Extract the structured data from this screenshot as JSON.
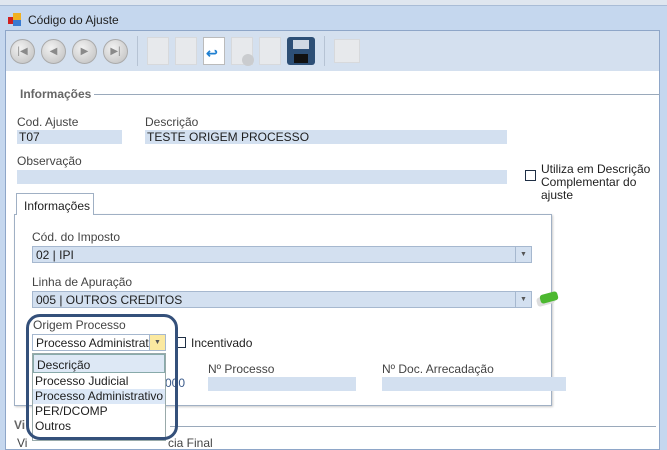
{
  "window": {
    "title": "Código do Ajuste"
  },
  "toolbar": {
    "buttons": [
      "first-icon",
      "previous-icon",
      "next-icon",
      "last-icon",
      "new-icon",
      "edit-icon",
      "undo-icon",
      "delete-icon",
      "redo-icon",
      "save-icon",
      "lock-icon"
    ]
  },
  "info": {
    "group_label": "Informações",
    "cod_label": "Cod. Ajuste",
    "cod_value": "T07",
    "desc_label": "Descrição",
    "desc_value": "TESTE ORIGEM PROCESSO",
    "obs_label": "Observação",
    "obs_value": "",
    "utiliza_label_1": "Utiliza em Descrição",
    "utiliza_label_2": "Complementar do ajuste"
  },
  "tab": {
    "label": "Informações"
  },
  "panel": {
    "imposto_label": "Cód. do Imposto",
    "imposto_value": "02 | IPI",
    "linha_label": "Linha de Apuração",
    "linha_value": "005 | OUTROS CREDITOS",
    "origem_label": "Origem Processo",
    "origem_value": "Processo Administrativo",
    "incentivado_label": "Incentivado",
    "hidden_value": "000",
    "nproc_label": "Nº Processo",
    "nproc_value": "",
    "ndoc_label": "Nº Doc. Arrecadação",
    "ndoc_value": ""
  },
  "dropdown": {
    "header": "Descrição",
    "options": [
      "Processo Judicial",
      "Processo Administrativo",
      "PER/DCOMP",
      "Outros"
    ],
    "selected": 1
  },
  "vigencia": {
    "group_label": "Vi",
    "start_label": "Vi",
    "end_label": "cia Final"
  }
}
